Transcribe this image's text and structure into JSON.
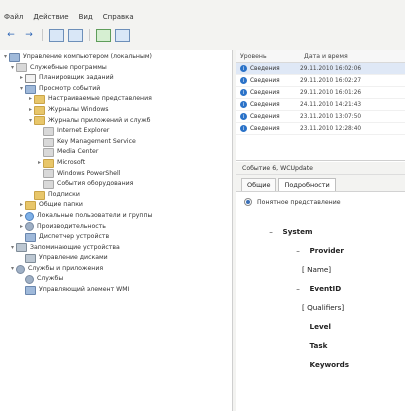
{
  "menu": {
    "items": [
      "Файл",
      "Действие",
      "Вид",
      "Справка"
    ]
  },
  "tree": {
    "root": "Управление компьютером (локальным)",
    "items": [
      {
        "label": "Служебные программы",
        "level": 1
      },
      {
        "label": "Планировщик заданий",
        "level": 2
      },
      {
        "label": "Просмотр событий",
        "level": 2
      },
      {
        "label": "Настраиваемые представления",
        "level": 3
      },
      {
        "label": "Журналы Windows",
        "level": 3
      },
      {
        "label": "Журналы приложений и служб",
        "level": 3
      },
      {
        "label": "Internet Explorer",
        "level": 4
      },
      {
        "label": "Key Management Service",
        "level": 4
      },
      {
        "label": "Media Center",
        "level": 4
      },
      {
        "label": "Microsoft",
        "level": 4
      },
      {
        "label": "Windows PowerShell",
        "level": 4
      },
      {
        "label": "События оборудования",
        "level": 4
      },
      {
        "label": "Подписки",
        "level": 3
      },
      {
        "label": "Общие папки",
        "level": 2
      },
      {
        "label": "Локальные пользователи и группы",
        "level": 2
      },
      {
        "label": "Производительность",
        "level": 2
      },
      {
        "label": "Диспетчер устройств",
        "level": 2
      },
      {
        "label": "Запоминающие устройства",
        "level": 1
      },
      {
        "label": "Управление дисками",
        "level": 2
      },
      {
        "label": "Службы и приложения",
        "level": 1
      },
      {
        "label": "Службы",
        "level": 2
      },
      {
        "label": "Управляющий элемент WMI",
        "level": 2
      }
    ]
  },
  "events": {
    "headers": {
      "level": "Уровень",
      "date": "Дата и время"
    },
    "rows": [
      {
        "level": "Сведения",
        "date": "29.11.2010 16:02:06"
      },
      {
        "level": "Сведения",
        "date": "29.11.2010 16:02:27"
      },
      {
        "level": "Сведения",
        "date": "29.11.2010 16:01:26"
      },
      {
        "level": "Сведения",
        "date": "24.11.2010 14:21:43"
      },
      {
        "level": "Сведения",
        "date": "23.11.2010 13:07:50"
      },
      {
        "level": "Сведения",
        "date": "23.11.2010 12:28:40"
      }
    ]
  },
  "properties": {
    "title": "Событие 6, WCUpdate",
    "tabs": {
      "general": "Общие",
      "details": "Подробности"
    },
    "view_mode": "Понятное представление",
    "xml": {
      "system": "System",
      "provider": "Provider",
      "name": "[ Name]",
      "eventid": "EventID",
      "qualifiers": "[ Qualifiers]",
      "level": "Level",
      "task": "Task",
      "keywords": "Keywords"
    }
  },
  "colors": {
    "accent": "#2a72c8",
    "selection": "#dfe8f6"
  }
}
